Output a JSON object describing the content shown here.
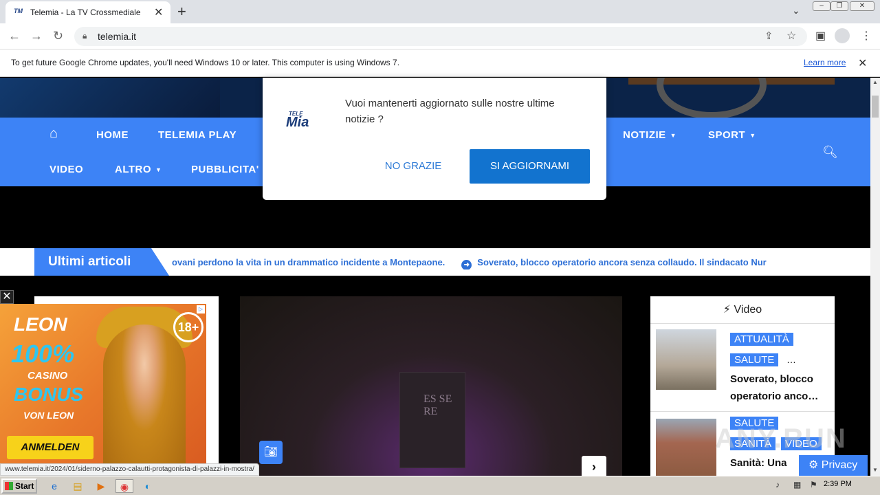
{
  "browser": {
    "tab_title": "Telemia - La TV Crossmediale",
    "url": "telemia.it",
    "infobar_message": "To get future Google Chrome updates, you'll need Windows 10 or later. This computer is using Windows 7.",
    "infobar_link": "Learn more"
  },
  "nav": {
    "items_row1": [
      "HOME",
      "TELEMIA PLAY",
      "NOTIZIE",
      "SPORT"
    ],
    "items_row2": [
      "VIDEO",
      "ALTRO",
      "PUBBLICITA'"
    ]
  },
  "ticker": {
    "label": "Ultimi articoli",
    "item1": "ovani perdono la vita in un drammatico incidente a Montepaone.",
    "item2": "Soverato, blocco operatorio ancora senza collaudo. Il sindacato Nur"
  },
  "main_image": {
    "banner_text": "ES SE RE"
  },
  "video_section": {
    "header": "Video",
    "items": [
      {
        "tags": [
          "ATTUALITÀ",
          "SALUTE"
        ],
        "ellipsis": "…",
        "title": "Soverato, blocco operatorio anco…"
      },
      {
        "tags": [
          "SALUTE",
          "SANITÀ",
          "VIDEO"
        ],
        "title": "Sanità: Una"
      }
    ]
  },
  "modal": {
    "logo_top": "TELE",
    "logo_main": "Mia",
    "message": "Vuoi mantenerti aggiornato sulle nostre ultime notizie ?",
    "decline": "NO GRAZIE",
    "accept": "SI AGGIORNAMI"
  },
  "ad": {
    "brand": "LEON",
    "headline": "100%",
    "casino": "CASINO",
    "bonus": "BONUS",
    "von": "VON LEON",
    "cta": "ANMELDEN",
    "age": "18+"
  },
  "status_url": "www.telemia.it/2024/01/siderno-palazzo-calautti-protagonista-di-palazzi-in-mostra/",
  "privacy": "Privacy",
  "watermark": "ANY.RUN",
  "taskbar": {
    "start": "Start",
    "time": "2:39 PM"
  },
  "colors": {
    "nav_blue": "#3d83f6",
    "button_blue": "#1273cf",
    "link_blue": "#2d6fd6"
  }
}
